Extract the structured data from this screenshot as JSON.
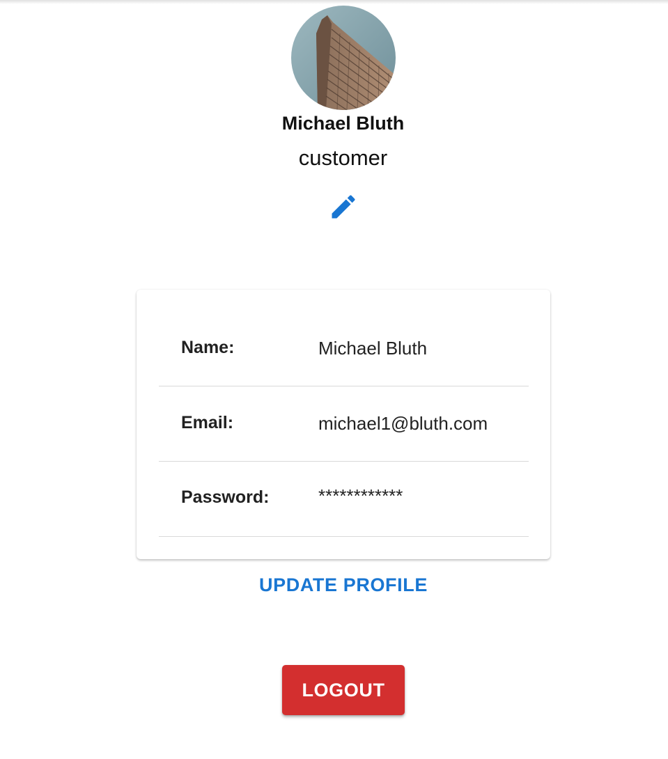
{
  "profile": {
    "name": "Michael Bluth",
    "role": "customer",
    "avatar_icon": "building-photo",
    "edit_icon": "pencil-icon"
  },
  "details": {
    "rows": [
      {
        "label": "Name:",
        "value": "Michael Bluth"
      },
      {
        "label": "Email:",
        "value": "michael1@bluth.com"
      },
      {
        "label": "Password:",
        "value": "************"
      }
    ]
  },
  "actions": {
    "update_label": "UPDATE PROFILE",
    "logout_label": "LOGOUT"
  },
  "colors": {
    "primary": "#1976d2",
    "danger": "#d32f2f",
    "text": "#212121"
  }
}
